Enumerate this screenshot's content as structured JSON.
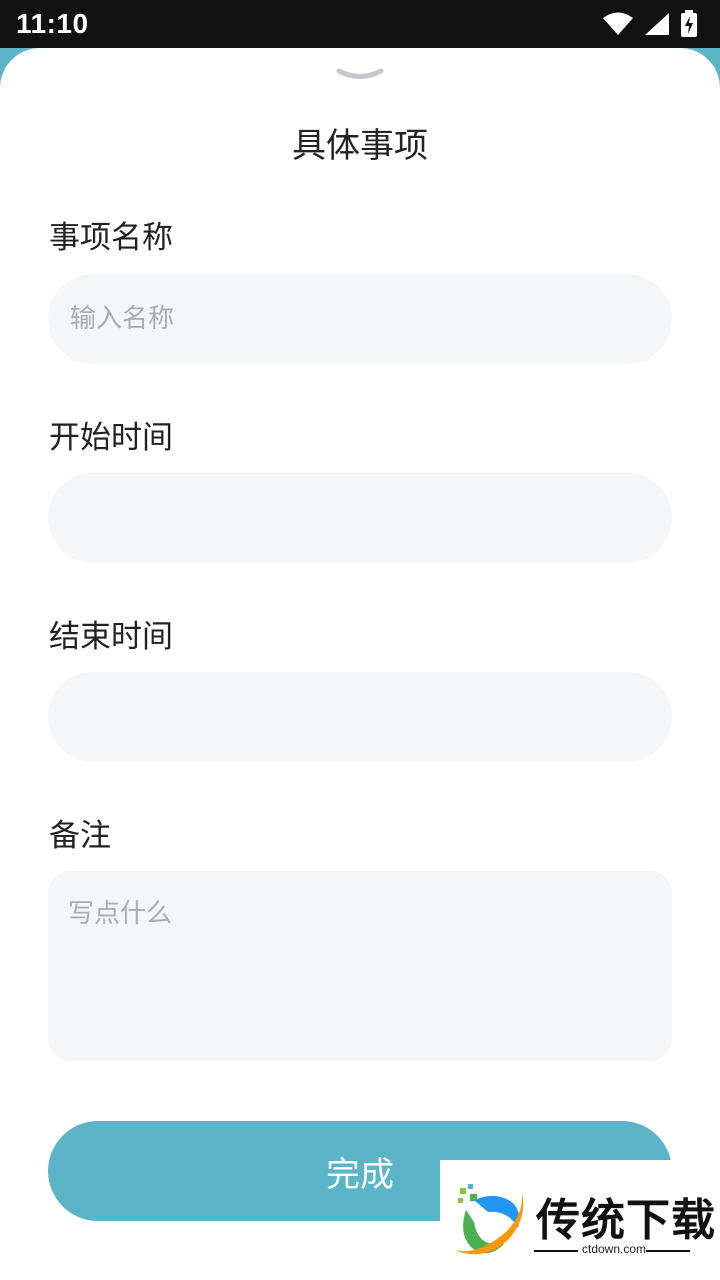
{
  "status_bar": {
    "time": "11:10",
    "icons": [
      "wifi-icon",
      "signal-icon",
      "battery-charging-icon"
    ]
  },
  "sheet": {
    "title": "具体事项",
    "handle_icon": "chevron-down-icon"
  },
  "form": {
    "name_label": "事项名称",
    "name_placeholder": "输入名称",
    "name_value": "",
    "start_label": "开始时间",
    "start_value": "",
    "end_label": "结束时间",
    "end_value": "",
    "note_label": "备注",
    "note_placeholder": "写点什么",
    "note_value": ""
  },
  "actions": {
    "done_label": "完成"
  },
  "watermark": {
    "brand": "传统下载",
    "url": "ctdown.com"
  },
  "colors": {
    "accent": "#5BB4C8",
    "input_bg": "#F5F6F8",
    "placeholder": "#A9ACB1",
    "status_bar": "#111111"
  }
}
